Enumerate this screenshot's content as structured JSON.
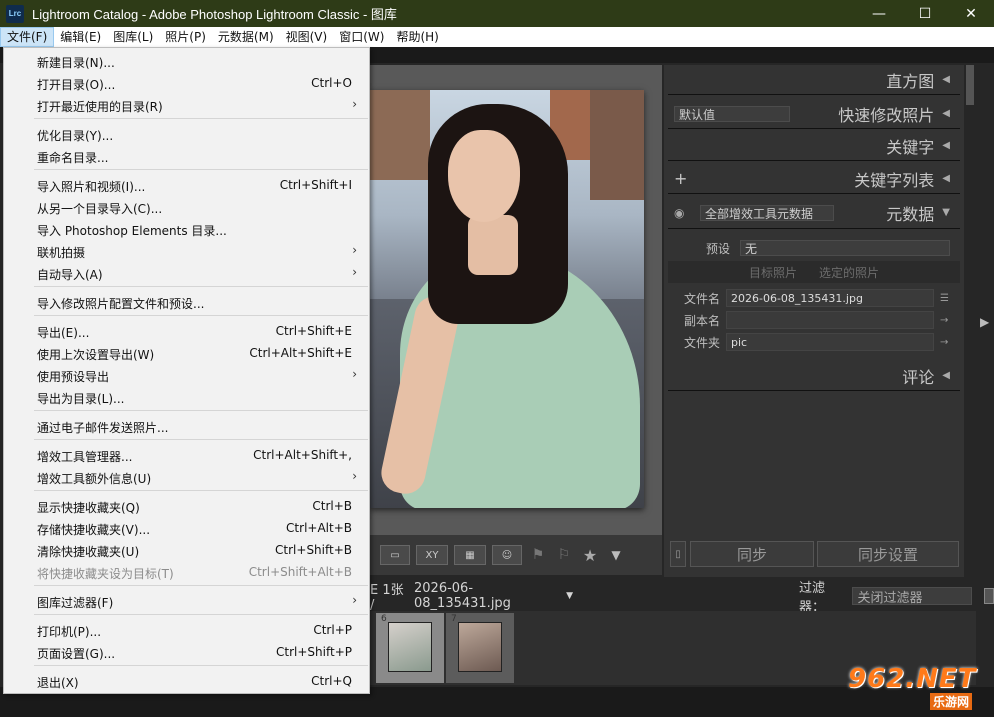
{
  "window": {
    "app_icon": "Lrc",
    "title": "Lightroom Catalog - Adobe Photoshop Lightroom Classic - 图库",
    "minimize": "—",
    "maximize": "☐",
    "close": "✕"
  },
  "menubar": [
    "文件(F)",
    "编辑(E)",
    "图库(L)",
    "照片(P)",
    "元数据(M)",
    "视图(V)",
    "窗口(W)",
    "帮助(H)"
  ],
  "file_menu": {
    "items": [
      {
        "label": "新建目录(N)...",
        "shortcut": "",
        "submenu": false,
        "enabled": true
      },
      {
        "label": "打开目录(O)...",
        "shortcut": "Ctrl+O",
        "submenu": false,
        "enabled": true
      },
      {
        "label": "打开最近使用的目录(R)",
        "shortcut": "",
        "submenu": true,
        "enabled": true
      },
      {
        "label": "优化目录(Y)...",
        "shortcut": "",
        "submenu": false,
        "enabled": true
      },
      {
        "label": "重命名目录...",
        "shortcut": "",
        "submenu": false,
        "enabled": true
      },
      {
        "label": "导入照片和视频(I)...",
        "shortcut": "Ctrl+Shift+I",
        "submenu": false,
        "enabled": true
      },
      {
        "label": "从另一个目录导入(C)...",
        "shortcut": "",
        "submenu": false,
        "enabled": true
      },
      {
        "label": "导入 Photoshop Elements 目录...",
        "shortcut": "",
        "submenu": false,
        "enabled": true
      },
      {
        "label": "联机拍摄",
        "shortcut": "",
        "submenu": true,
        "enabled": true
      },
      {
        "label": "自动导入(A)",
        "shortcut": "",
        "submenu": true,
        "enabled": true
      },
      {
        "label": "导入修改照片配置文件和预设...",
        "shortcut": "",
        "submenu": false,
        "enabled": true
      },
      {
        "label": "导出(E)...",
        "shortcut": "Ctrl+Shift+E",
        "submenu": false,
        "enabled": true
      },
      {
        "label": "使用上次设置导出(W)",
        "shortcut": "Ctrl+Alt+Shift+E",
        "submenu": false,
        "enabled": true
      },
      {
        "label": "使用预设导出",
        "shortcut": "",
        "submenu": true,
        "enabled": true
      },
      {
        "label": "导出为目录(L)...",
        "shortcut": "",
        "submenu": false,
        "enabled": true
      },
      {
        "label": "通过电子邮件发送照片...",
        "shortcut": "",
        "submenu": false,
        "enabled": true
      },
      {
        "label": "增效工具管理器...",
        "shortcut": "Ctrl+Alt+Shift+,",
        "submenu": false,
        "enabled": true
      },
      {
        "label": "增效工具额外信息(U)",
        "shortcut": "",
        "submenu": true,
        "enabled": true
      },
      {
        "label": "显示快捷收藏夹(Q)",
        "shortcut": "Ctrl+B",
        "submenu": false,
        "enabled": true
      },
      {
        "label": "存储快捷收藏夹(V)...",
        "shortcut": "Ctrl+Alt+B",
        "submenu": false,
        "enabled": true
      },
      {
        "label": "清除快捷收藏夹(U)",
        "shortcut": "Ctrl+Shift+B",
        "submenu": false,
        "enabled": true
      },
      {
        "label": "将快捷收藏夹设为目标(T)",
        "shortcut": "Ctrl+Shift+Alt+B",
        "submenu": false,
        "enabled": false
      },
      {
        "label": "图库过滤器(F)",
        "shortcut": "",
        "submenu": true,
        "enabled": true
      },
      {
        "label": "打印机(P)...",
        "shortcut": "Ctrl+P",
        "submenu": false,
        "enabled": true
      },
      {
        "label": "页面设置(G)...",
        "shortcut": "Ctrl+Shift+P",
        "submenu": false,
        "enabled": true
      },
      {
        "label": "退出(X)",
        "shortcut": "Ctrl+Q",
        "submenu": false,
        "enabled": true
      }
    ],
    "submenu_arrow": "›"
  },
  "right_panel": {
    "histogram": "直方图",
    "quick_develop": "快速修改照片",
    "quick_develop_preset": "默认值",
    "keywording": "关键字",
    "keyword_list": "关键字列表",
    "keyword_add": "+",
    "metadata": "元数据",
    "metadata_set": "全部增效工具元数据",
    "preset_label": "预设",
    "preset_value": "无",
    "target_photo": "目标照片",
    "selected_photos": "选定的照片",
    "file_name_label": "文件名",
    "file_name_value": "2026-06-08_135431.jpg",
    "copy_name_label": "副本名",
    "copy_name_value": "",
    "folder_label": "文件夹",
    "folder_value": "pic",
    "comments": "评论",
    "sync": "同步",
    "sync_settings": "同步设置",
    "collapse_tri": "◀",
    "expand_tri": "▼"
  },
  "filmstrip": {
    "path_prefix": "E 1张 /",
    "path_file": "2026-06-08_135431.jpg",
    "filter_label": "过滤器：",
    "filter_value": "关闭过滤器",
    "thumb1_num": "6",
    "thumb2_num": "7"
  },
  "watermark": {
    "top": "962.NET",
    "bottom": "乐游网"
  }
}
